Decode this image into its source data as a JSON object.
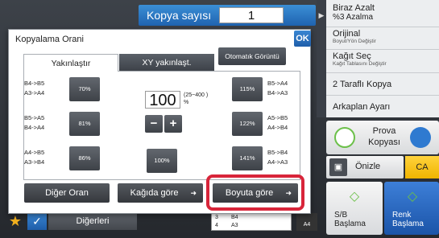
{
  "header": {
    "copies_label": "Kopya sayısı",
    "copies_value": "1"
  },
  "right_panel": {
    "edge_glyph": "▶",
    "items": [
      {
        "main": "Biraz Azalt",
        "sub": "%3 Azalma"
      },
      {
        "main": "Orijinal",
        "sub": "Boyut/Yön Değiştir"
      },
      {
        "main": "Kağıt Seç",
        "sub": "Kağıt Tablasını Değiştir"
      },
      {
        "main": "2 Taraflı Kopya",
        "sub": ""
      },
      {
        "main": "Arkaplan Ayarı",
        "sub": ""
      }
    ],
    "proof_copy": "Prova Kopyası",
    "preview": "Önizle",
    "ca": "CA",
    "bw_start": "S/B Başlama",
    "color_start": "Renk Başlama"
  },
  "dialog": {
    "title": "Kopyalama Orani",
    "ok": "OK",
    "auto_image": "Otomatık Görüntü",
    "tabs": [
      "Yakınlaştır",
      "XY yakınlaşt."
    ],
    "presets_left": [
      {
        "line1": "B4->B5",
        "line2": "A3->A4",
        "value": "70%"
      },
      {
        "line1": "B5->A5",
        "line2": "B4->A4",
        "value": "81%"
      },
      {
        "line1": "A4->B5",
        "line2": "A3->B4",
        "value": "86%"
      }
    ],
    "presets_right": [
      {
        "line1": "B5->A4",
        "line2": "B4->A3",
        "value": "115%"
      },
      {
        "line1": "A5->B5",
        "line2": "A4->B4",
        "value": "122%"
      },
      {
        "line1": "B5->B4",
        "line2": "A4->A3",
        "value": "141%"
      }
    ],
    "hundred": "100%",
    "ratio_value": "100",
    "range_text": "(25~400 )",
    "percent": "%",
    "minus": "−",
    "plus": "+",
    "other_ratio": "Diğer Oran",
    "by_paper": "Kağıda göre",
    "by_size": "Boyuta göre"
  },
  "bottom": {
    "others": "Diğerleri",
    "tray_rows": [
      {
        "n": "3",
        "size": "B4"
      },
      {
        "n": "4",
        "size": "A3"
      }
    ],
    "paper": "A4"
  },
  "colors": {
    "accent_blue": "#1f63b0",
    "highlight_red": "#d8253a",
    "ca_yellow": "#f5c21a"
  }
}
